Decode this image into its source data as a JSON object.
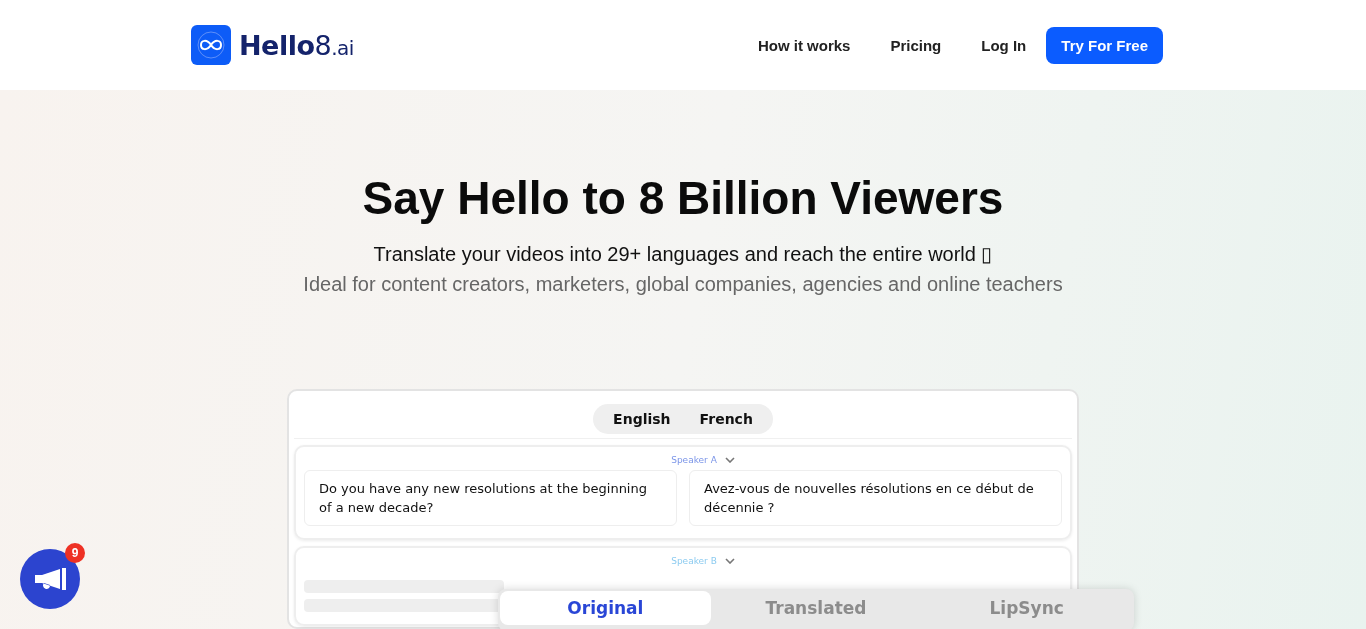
{
  "header": {
    "logo": {
      "name": "Hello",
      "suffix": "8",
      "tld": ".ai"
    },
    "nav": [
      "How it works",
      "Pricing",
      "Log In"
    ],
    "cta": "Try For Free"
  },
  "hero": {
    "title": "Say Hello to 8 Billion Viewers",
    "subtitle": "Translate your videos into 29+ languages and reach the entire world ▯",
    "tagline": "Ideal for content creators, marketers, global companies, agencies and online teachers"
  },
  "demo": {
    "languages": [
      "English",
      "French"
    ],
    "speakers": [
      {
        "label": "Speaker A",
        "color": "#7b95e8",
        "original": "Do you have any new resolutions at the beginning of a new decade?",
        "translated": "Avez-vous de nouvelles résolutions en ce début de décennie ?"
      },
      {
        "label": "Speaker B",
        "color": "#8ccbf0"
      }
    ],
    "video_tabs": [
      {
        "label": "Original",
        "selected": true
      },
      {
        "label": "Translated",
        "selected": false
      },
      {
        "label": "LipSync",
        "selected": false
      }
    ]
  },
  "announcement": {
    "badge": "9"
  }
}
